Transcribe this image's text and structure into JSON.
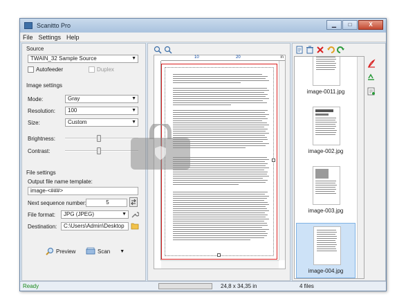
{
  "window": {
    "title": "Scanitto Pro",
    "min_label": "▁",
    "max_label": "□",
    "close_label": "X"
  },
  "menu": [
    "File",
    "Settings",
    "Help"
  ],
  "source": {
    "section": "Source",
    "device": "TWAIN_32 Sample Source",
    "autofeeder_label": "Autofeeder",
    "duplex_label": "Duplex"
  },
  "image_settings": {
    "section": "Image settings",
    "mode_label": "Mode:",
    "mode_value": "Gray",
    "resolution_label": "Resolution:",
    "resolution_value": "100",
    "size_label": "Size:",
    "size_value": "Custom",
    "brightness_label": "Brightness:",
    "contrast_label": "Contrast:"
  },
  "file_settings": {
    "section": "File settings",
    "template_label": "Output file name template:",
    "template_value": "image-<###>",
    "sequence_label": "Next sequence number:",
    "sequence_value": "5",
    "format_label": "File format:",
    "format_value": "JPG (JPEG)",
    "destination_label": "Destination:",
    "destination_value": "C:\\Users\\Admin\\Desktop"
  },
  "actions": {
    "preview_label": "Preview",
    "scan_label": "Scan"
  },
  "ruler": {
    "mark1": "10",
    "mark2": "20",
    "unit": "in"
  },
  "thumbnails": [
    {
      "name": "image-0011.jpg",
      "selected": false
    },
    {
      "name": "image-002.jpg",
      "selected": false
    },
    {
      "name": "image-003.jpg",
      "selected": false
    },
    {
      "name": "image-004.jpg",
      "selected": true
    }
  ],
  "status": {
    "ready": "Ready",
    "dimensions": "24,8 x 34,35 in",
    "files": "4 files"
  },
  "colors": {
    "accent": "#3d6fa6",
    "page_border": "#d81e1e",
    "status_ok": "#1a8a1a",
    "delete_red": "#d82020"
  }
}
